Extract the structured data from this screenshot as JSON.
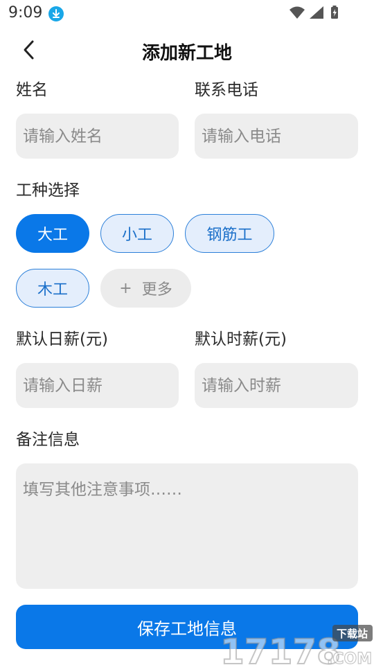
{
  "status_bar": {
    "time": "9:09"
  },
  "header": {
    "title": "添加新工地"
  },
  "form": {
    "name_label": "姓名",
    "name_placeholder": "请输入姓名",
    "phone_label": "联系电话",
    "phone_placeholder": "请输入电话",
    "worktype_label": "工种选择",
    "worktypes": [
      {
        "label": "大工",
        "selected": true
      },
      {
        "label": "小工",
        "selected": false
      },
      {
        "label": "钢筋工",
        "selected": false
      },
      {
        "label": "木工",
        "selected": false
      }
    ],
    "more_label": "更多",
    "daily_wage_label": "默认日薪(元)",
    "daily_wage_placeholder": "请输入日薪",
    "hourly_wage_label": "默认时薪(元)",
    "hourly_wage_placeholder": "请输入时薪",
    "notes_label": "备注信息",
    "notes_placeholder": "填写其他注意事项……"
  },
  "actions": {
    "save_label": "保存工地信息"
  },
  "watermark": {
    "main": "17178",
    "suffix": ".COM",
    "tag": "下载站"
  },
  "colors": {
    "accent": "#0a78e8",
    "chip_bg": "#e4eefc",
    "input_bg": "#eeeeee"
  }
}
